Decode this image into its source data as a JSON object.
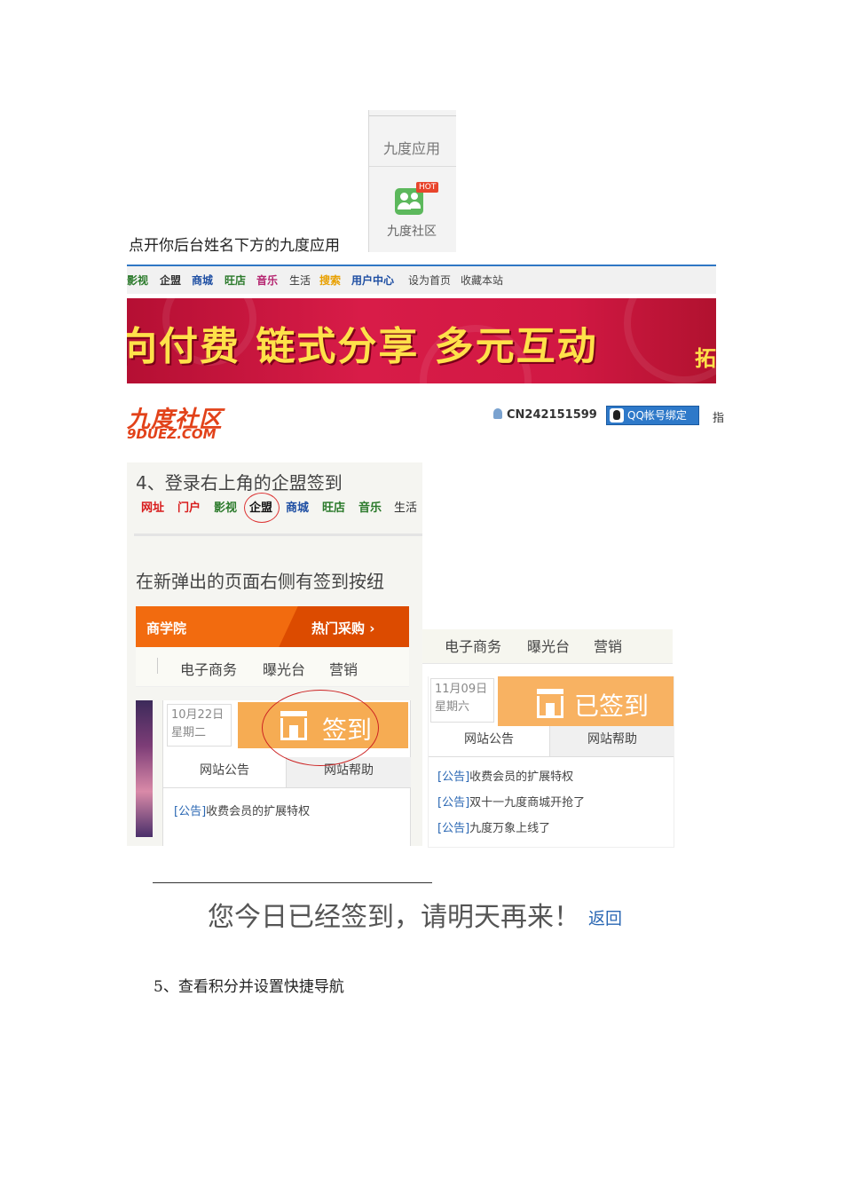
{
  "app_panel": {
    "title": "九度应用",
    "badge": "HOT",
    "app_name": "九度社区"
  },
  "caption_1": "点开你后台姓名下方的九度应用",
  "site_nav": {
    "items": [
      "影视",
      "企盟",
      "商城",
      "旺店",
      "音乐",
      "生活",
      "搜索",
      "用户中心",
      "设为首页",
      "收藏本站"
    ],
    "colors": [
      "#2b7a2b",
      "#333333",
      "#1f4fa3",
      "#2b7a2b",
      "#b52570",
      "#333333",
      "#e8a000",
      "#1f4fa3",
      "#444444",
      "#444444"
    ]
  },
  "banner": {
    "text": "向付费 链式分享 多元互动",
    "corner": "拓",
    "bg": "#d81c48",
    "text_color": "#ffe14a"
  },
  "logo": {
    "main": "九度社区",
    "sub": "9DUEZ.COM"
  },
  "user": {
    "name": "CN242151599",
    "qq_button": "QQ帐号绑定",
    "cut": "指"
  },
  "step4": {
    "heading": "4、登录右上角的企盟签到",
    "nav": [
      "网址",
      "门户",
      "影视",
      "企盟",
      "商城",
      "旺店",
      "音乐",
      "生活"
    ],
    "nav_colors": [
      "#d81b1b",
      "#d81b1b",
      "#2b7a2b",
      "#111111",
      "#1f4fa3",
      "#2b7a2b",
      "#2b7a2b",
      "#333333"
    ],
    "instruction": "在新弹出的页面右侧有签到按纽",
    "bar_left": "商学院",
    "bar_right": "热门采购 ›",
    "tabs": [
      "电子商务",
      "曝光台",
      "营销"
    ],
    "date": "10月22日",
    "weekday": "星期二",
    "sign_button": "签到",
    "sub_tabs": [
      "网站公告",
      "网站帮助"
    ],
    "notice": {
      "tag": "[公告]",
      "text": "收费会员的扩展特权"
    }
  },
  "signed_panel": {
    "tabs": [
      "电子商务",
      "曝光台",
      "营销"
    ],
    "date": "11月09日",
    "weekday": "星期六",
    "signed_button": "已签到",
    "sub_tabs": [
      "网站公告",
      "网站帮助"
    ],
    "notices": [
      {
        "tag": "[公告]",
        "text": "收费会员的扩展特权"
      },
      {
        "tag": "[公告]",
        "text": "双十一九度商城开抢了"
      },
      {
        "tag": "[公告]",
        "text": "九度万象上线了"
      }
    ]
  },
  "message": {
    "text": "您今日已经签到，请明天再来！",
    "link": "返回"
  },
  "caption_5": "5、查看积分并设置快捷导航"
}
